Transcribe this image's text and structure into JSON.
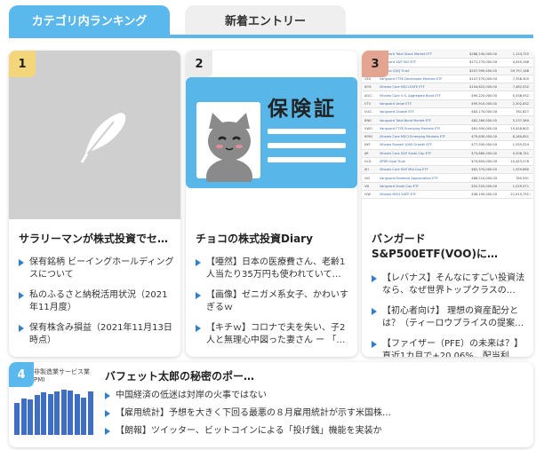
{
  "tabs": {
    "active": "カテゴリ内ランキング",
    "inactive": "新着エントリー"
  },
  "colors": {
    "accent": "#5bb8ec",
    "rank1": "#f3d57a",
    "rank2": "#ebebeb",
    "rank3": "#e3a58f",
    "rank4": "#5bb8ec",
    "bullet": "#2f80c8"
  },
  "cards": [
    {
      "rank": "1",
      "title": "サラリーマンが株式投資でセ…",
      "thumb_icon": "feather-icon",
      "links": [
        "保有銘柄 ビーイングホールディングスについて",
        "私のふるさと納税活用状況（2021年11月度）",
        "保有株含み損益（2021年11月13日時点）"
      ]
    },
    {
      "rank": "2",
      "title": "チョコの株式投資Diary",
      "thumb_text": "保険証",
      "links": [
        "【唖然】日本の医療費さん、老齢1人当たり35万円も使われていて…",
        "【画像】ゼニガメ系女子、かわいすぎるｗ",
        "【キチｗ】コロナで夫を失い、子2人と無理心中図った妻さん ー 「…"
      ]
    },
    {
      "rank": "3",
      "title": "バンガードS&P500ETF(VOO)に…",
      "links": [
        "【レバナス】そんなにすごい投資法なら、なぜ世界トップクラスの…",
        "【初心者向け】 理想の資産配分とは？（ティーロウプライスの提案…",
        "【ファイザー（PFE）の未来は？】直近1カ月で+20.06%，配当利…"
      ],
      "thumb_table": [
        [
          "VTI",
          "Vanguard Total Stock Market ETF",
          "$268,240,000.00",
          "1,124,725"
        ],
        [
          "VOO",
          "Vanguard S&P 500 ETF",
          "$271,270,000.00",
          "4,450,168"
        ],
        [
          "QQQ",
          "Invesco QQQ Trust",
          "$207,990,000.00",
          "39,797,188"
        ],
        [
          "VEA",
          "Vanguard FTSE Developed Markets ETF",
          "$107,570,000.00",
          "7,358,305"
        ],
        [
          "IEFA",
          "iShares Core MSCI EAFE ETF",
          "$104,610,000.00",
          "7,482,532"
        ],
        [
          "AGG",
          "iShares Core U.S. Aggregate Bond ETF",
          "$90,220,000.00",
          "5,438,932"
        ],
        [
          "VTV",
          "Vanguard Value ETF",
          "$95,910,000.00",
          "2,302,832"
        ],
        [
          "VUG",
          "Vanguard Growth ETF",
          "$83,170,000.00",
          "781,827"
        ],
        [
          "BND",
          "Vanguard Total Bond Market ETF",
          "$82,260,000.00",
          "5,237,364"
        ],
        [
          "VWO",
          "Vanguard FTSE Emerging Markets ETF",
          "$81,950,000.00",
          "10,428,802"
        ],
        [
          "IEMG",
          "iShares Core MSCI Emerging Markets ETF",
          "$79,630,000.00",
          "8,180,851"
        ],
        [
          "IWF",
          "iShares Russell 1000 Growth ETF",
          "$77,930,000.00",
          "1,555,524"
        ],
        [
          "IJR",
          "iShares Core S&P Small-Cap ETF",
          "$73,860,000.00",
          "5,208,741"
        ],
        [
          "GLD",
          "SPDR Gold Trust",
          "$74,650,000.00",
          "10,423,576"
        ],
        [
          "IJH",
          "iShares Core S&P Mid-Cap ETF",
          "$62,370,000.00",
          "1,559,860"
        ],
        [
          "VIG",
          "Vanguard Dividend Appreciation ETF",
          "$66,210,000.00",
          "760,591"
        ],
        [
          "VB",
          "Vanguard Small-Cap ETF",
          "$52,520,000.00",
          "1,029,571"
        ],
        [
          "IVW",
          "iShares MSCI EAFE ETF",
          "$58,190,000.00",
          "21,915,792"
        ]
      ]
    }
  ],
  "bottom_card": {
    "rank": "4",
    "title": "バフェット太郎の秘密のポー…",
    "thumb_label": "非製造業サービス業PMI",
    "thumb_bar_levels": [
      0.55,
      0.62,
      0.6,
      0.68,
      0.72,
      0.7,
      0.74,
      0.78,
      0.76,
      0.7,
      0.64,
      0.74
    ],
    "links": [
      "中国経済の低迷は対岸の火事ではない",
      "【雇用統計】予想を大きく下回る最悪の８月雇用統計が示す米国株…",
      "【朗報】ツイッター、ビットコインによる「投げ銭」機能を実装か"
    ]
  }
}
